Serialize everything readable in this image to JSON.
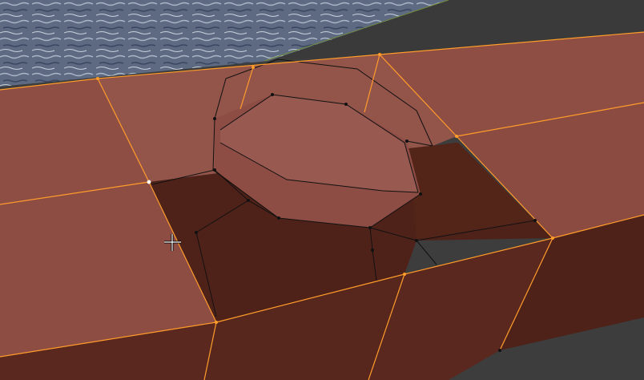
{
  "viewport": {
    "mode": "edit-mode",
    "colors": {
      "background": "#3d3d3d",
      "selected_face": "#8e4e44",
      "selected_face_light": "#9a5a50",
      "inner_face": "#4f2219",
      "side_face": "#5a281f",
      "selected_edge": "#ff9c2a",
      "unselected_edge": "#111111",
      "active_vertex": "#ffffff"
    }
  },
  "cursor": {
    "icon": "crosshair-icon"
  }
}
